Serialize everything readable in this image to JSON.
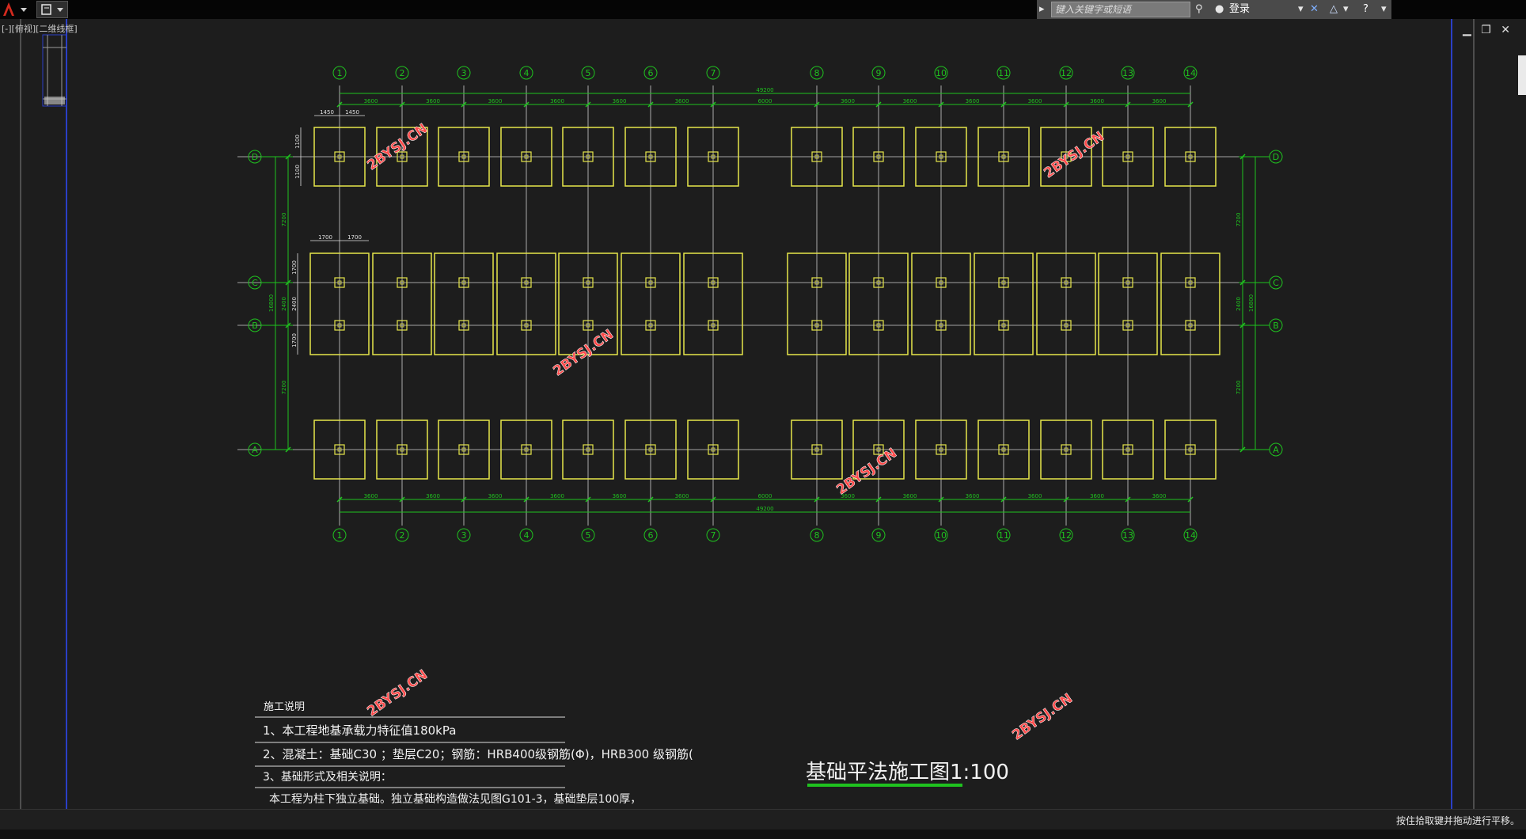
{
  "topbar": {
    "search_placeholder": "键入关键字或短语",
    "login_label": "登录"
  },
  "view": {
    "label": "[-][俯视][二维线框]"
  },
  "plan": {
    "top_dims": [
      "3600",
      "3600",
      "3600",
      "3600",
      "3600",
      "3600",
      "6000",
      "3600",
      "3600",
      "3600",
      "3600",
      "3600",
      "3600"
    ],
    "top_total": "49200",
    "bottom_dims": [
      "3600",
      "3600",
      "3600",
      "3600",
      "3600",
      "3600",
      "6000",
      "3600",
      "3600",
      "3600",
      "3600",
      "3600",
      "3600"
    ],
    "bottom_total": "49200",
    "left_dims": [
      "7200",
      "2400",
      "7200"
    ],
    "left_total": "16800",
    "right_dims": [
      "7200",
      "2400",
      "7200"
    ],
    "right_total": "16800",
    "footing_small_dims": [
      "1450",
      "1450"
    ],
    "footing_small_vdims": [
      "1100",
      "1100"
    ],
    "footing_big_dims": [
      "1700",
      "1700"
    ],
    "footing_big_vdims": [
      "1700",
      "2400",
      "1700"
    ],
    "column_axes": [
      "1",
      "2",
      "3",
      "4",
      "5",
      "6",
      "7",
      "8",
      "9",
      "10",
      "11",
      "12",
      "13",
      "14"
    ],
    "row_axes": [
      "D",
      "C",
      "B",
      "A"
    ]
  },
  "notes": {
    "heading": "施工说明",
    "line1": "1、本工程地基承载力特征值180kPa",
    "line2": "2、混凝土：基础C30 ；垫层C20；钢筋：HRB400级钢筋(Φ)，HRB300 级钢筋(",
    "line3": "3、基础形式及相关说明：",
    "line4": "本工程为柱下独立基础。独立基础构造做法见图G101-3，基础垫层100厚，"
  },
  "drawing_title": "基础平法施工图1:100",
  "watermark": "2BYSJ.CN",
  "statusbar": {
    "hint": "按住拾取键并拖动进行平移。"
  },
  "colors": {
    "axis": "#1fc21f",
    "footing": "#e6e64b",
    "background": "#1d1d1d",
    "watermark": "#ff4a4a",
    "gridline": "#cfcfcf"
  }
}
